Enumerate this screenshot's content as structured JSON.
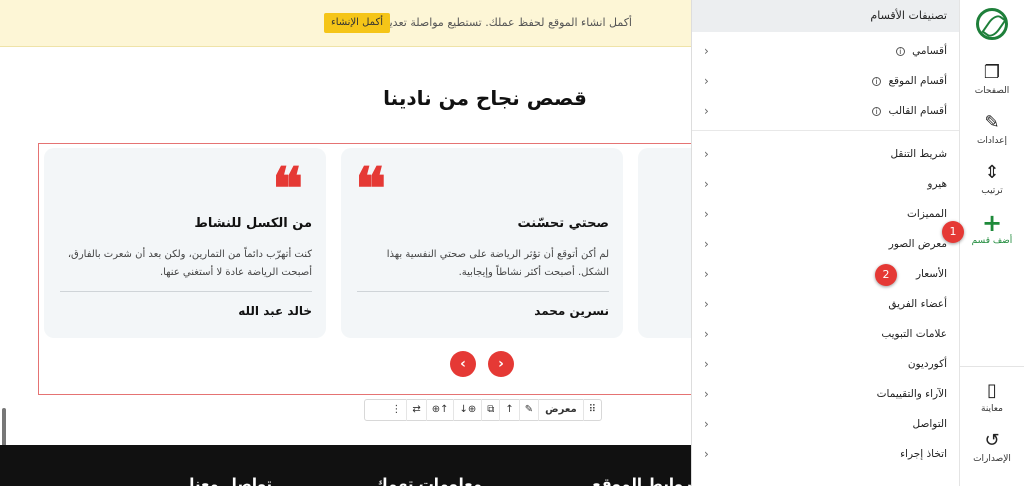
{
  "notice": {
    "text": "أكمل انشاء الموقع لحفظ عملك. تستطيع مواصلة تعديله بأي وقت",
    "button": "أكمل الإنشاء"
  },
  "section": {
    "title": "قصص نجاح من نادينا",
    "cards": [
      {
        "title": "من الكسل للنشاط",
        "body_line1": "كنت أتهرّب دائماً من التمارين، ولكن بعد أن شعرت بالفارق،",
        "body_line2": "أصبحت الرياضة عادة لا أستغني عنها.",
        "author": "خالد عبد الله"
      },
      {
        "title": "صحتي تحسّنت",
        "body_line1": "لم أكن أتوقع أن تؤثر الرياضة على صحتي النفسية بهذا",
        "body_line2": "الشكل. أصبحت أكثر نشاطاً وإيجابية.",
        "author": "نسرين محمد"
      }
    ],
    "prev_arrow": "‹",
    "next_arrow": "›"
  },
  "toolbar": {
    "label": "معرض",
    "drag": "⠿",
    "edit": "✎",
    "move_up": "↑",
    "copy": "⧉",
    "add_below": "↓⊕",
    "add_above": "⊕↑",
    "swap": "⇄",
    "more": "⋮"
  },
  "footer": {
    "col1": "روابط الموقع",
    "col2": "معلومات تهمك",
    "col3": "تواصل معنا"
  },
  "panel": {
    "header": "تصنيفات الأقسام",
    "info_symbol": "i",
    "chevron": "‹",
    "groups": [
      [
        "أقسامي",
        "أقسام الموقع",
        "أقسام القالب"
      ],
      [
        "شريط التنقل",
        "هيرو",
        "المميزات",
        "معرض الصور",
        "الأسعار",
        "أعضاء الفريق",
        "علامات التبويب",
        "أكورديون",
        "الآراء والتقييمات",
        "التواصل",
        "اتخاذ إجراء"
      ]
    ]
  },
  "rail": {
    "pages": "الصفحات",
    "settings": "إعدادات",
    "order": "ترتيب",
    "add_section": "أضف قسم",
    "preview": "معاينة",
    "versions": "الإصدارات",
    "pages_icon": "❐",
    "settings_icon": "✎",
    "order_icon": "⇕",
    "add_icon": "+",
    "preview_icon": "▯",
    "versions_icon": "↺"
  },
  "badges": {
    "one": "1",
    "two": "2"
  },
  "colors": {
    "accent": "#e53935",
    "brand": "#1e8a3a",
    "notice_bg": "#fdf6d6",
    "notice_btn": "#f5c518"
  }
}
